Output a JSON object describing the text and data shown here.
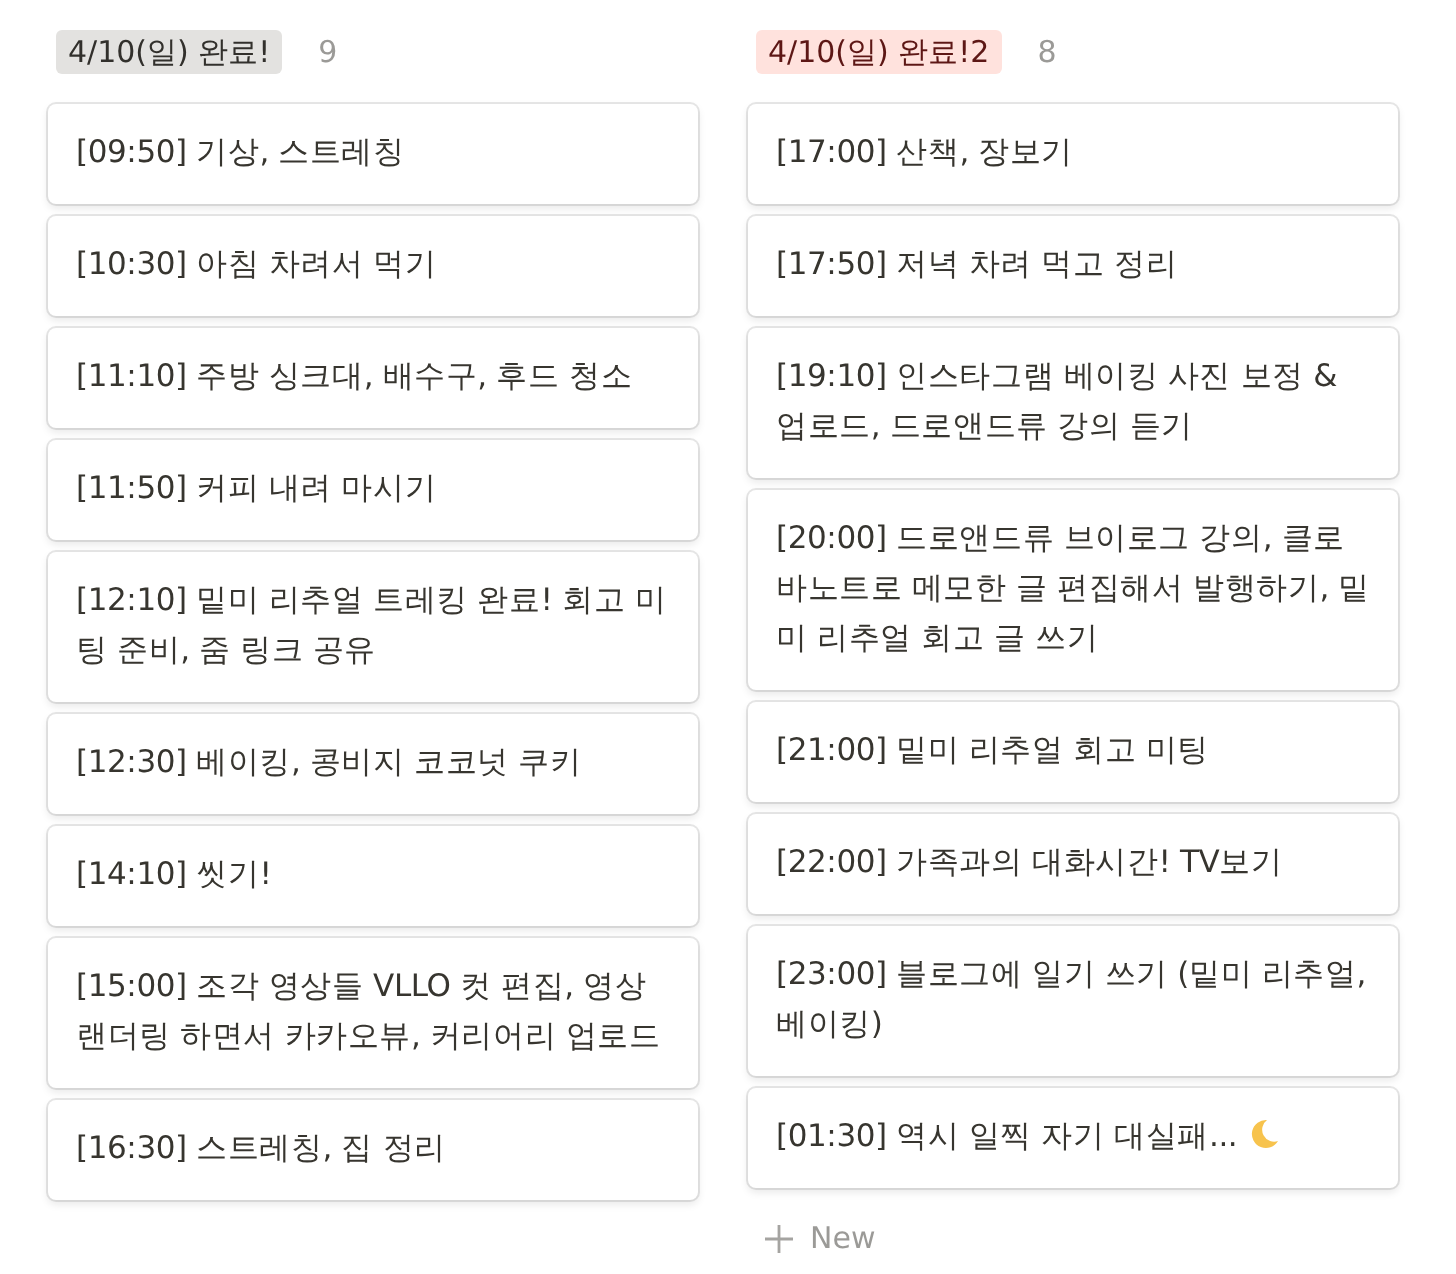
{
  "columns": [
    {
      "title": "4/10(일) 완료!",
      "color": "#e3e2e0",
      "count": "9",
      "cards": [
        {
          "text": "[09:50] 기상, 스트레칭",
          "trailing_icon": false
        },
        {
          "text": "[10:30] 아침 차려서 먹기",
          "trailing_icon": false
        },
        {
          "text": "[11:10] 주방 싱크대, 배수구, 후드 청소",
          "trailing_icon": false
        },
        {
          "text": "[11:50] 커피 내려 마시기",
          "trailing_icon": false
        },
        {
          "text": "[12:10] 밑미 리추얼 트레킹 완료! 회고 미팅 준비, 줌 링크 공유",
          "trailing_icon": false
        },
        {
          "text": "[12:30] 베이킹, 콩비지 코코넛 쿠키",
          "trailing_icon": false
        },
        {
          "text": "[14:10] 씻기!",
          "trailing_icon": false
        },
        {
          "text": "[15:00] 조각 영상들 VLLO 컷 편집, 영상 랜더링 하면서 카카오뷰, 커리어리 업로드",
          "trailing_icon": false
        },
        {
          "text": "[16:30] 스트레칭, 집 정리",
          "trailing_icon": false
        }
      ]
    },
    {
      "title": "4/10(일) 완료!2",
      "color": "#ffe2dd",
      "count": "8",
      "cards": [
        {
          "text": "[17:00] 산책, 장보기",
          "trailing_icon": false
        },
        {
          "text": "[17:50] 저녁 차려 먹고 정리",
          "trailing_icon": false
        },
        {
          "text": "[19:10] 인스타그램 베이킹 사진 보정 & 업로드, 드로앤드류 강의 듣기",
          "trailing_icon": false
        },
        {
          "text": "[20:00] 드로앤드류 브이로그 강의, 클로바노트로 메모한 글 편집해서 발행하기, 밑미 리추얼 회고 글 쓰기",
          "trailing_icon": false
        },
        {
          "text": "[21:00] 밑미 리추얼 회고 미팅",
          "trailing_icon": false
        },
        {
          "text": "[22:00] 가족과의 대화시간! TV보기",
          "trailing_icon": false
        },
        {
          "text": "[23:00] 블로그에 일기 쓰기 (밑미 리추얼, 베이킹)",
          "trailing_icon": false
        },
        {
          "text": "[01:30] 역시 일찍 자기 대실패...",
          "trailing_icon": true
        }
      ],
      "add_button": {
        "label": "New"
      }
    }
  ]
}
